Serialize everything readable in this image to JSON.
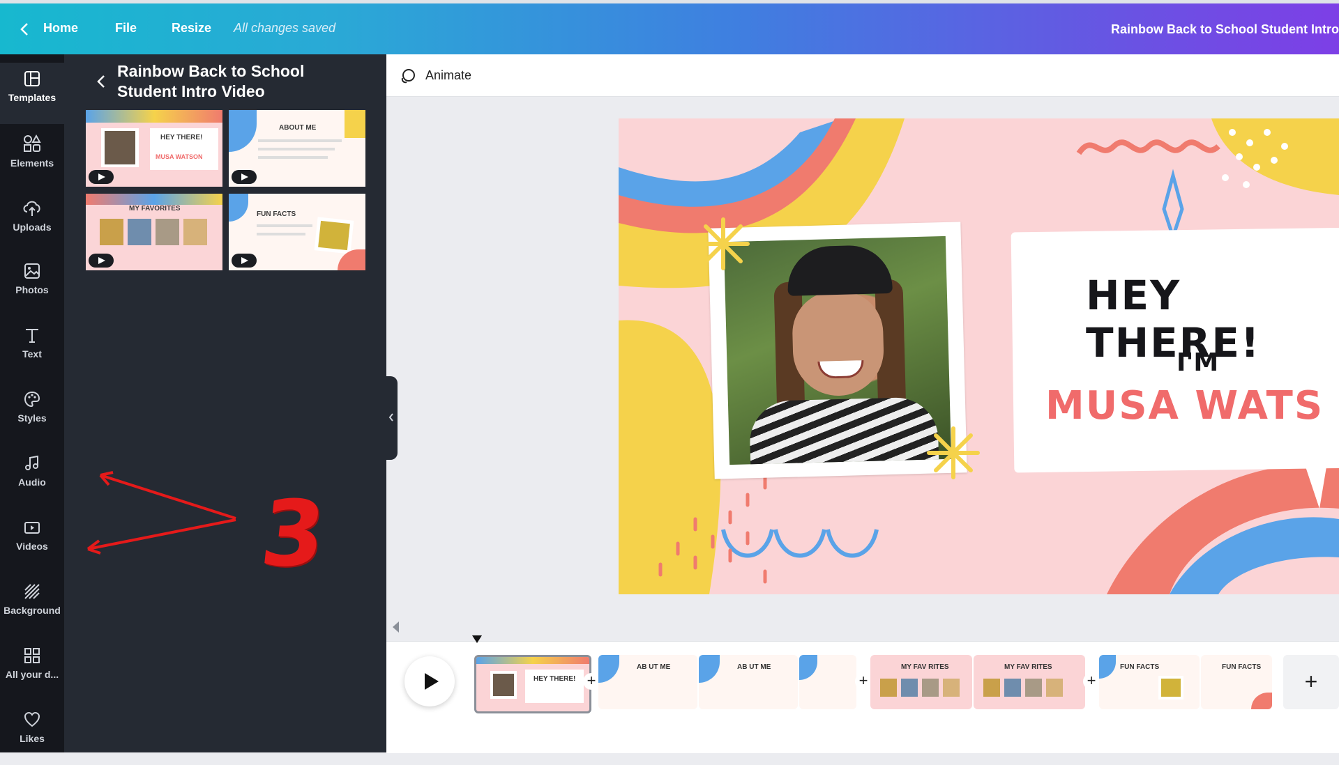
{
  "topbar": {
    "home_label": "Home",
    "file_label": "File",
    "resize_label": "Resize",
    "saved_status": "All changes saved",
    "document_title": "Rainbow Back to School Student Intro"
  },
  "rail": {
    "items": [
      {
        "label": "Templates",
        "icon": "templates-icon"
      },
      {
        "label": "Elements",
        "icon": "elements-icon"
      },
      {
        "label": "Uploads",
        "icon": "upload-cloud-icon"
      },
      {
        "label": "Photos",
        "icon": "photo-icon"
      },
      {
        "label": "Text",
        "icon": "text-icon"
      },
      {
        "label": "Styles",
        "icon": "palette-icon"
      },
      {
        "label": "Audio",
        "icon": "music-note-icon"
      },
      {
        "label": "Videos",
        "icon": "video-icon"
      },
      {
        "label": "Background",
        "icon": "background-hatch-icon"
      },
      {
        "label": "All your d...",
        "icon": "grid-icon"
      },
      {
        "label": "Likes",
        "icon": "heart-icon"
      }
    ]
  },
  "panel": {
    "title": "Rainbow Back to School Student Intro Video",
    "thumbnails": [
      {
        "caption": "HEY THERE!"
      },
      {
        "caption": "ABOUT ME"
      },
      {
        "caption": "MY FAVORITES"
      },
      {
        "caption": "FUN FACTS"
      }
    ]
  },
  "toolbar": {
    "animate_label": "Animate"
  },
  "slide": {
    "headline": "HEY THERE!",
    "intro": "I'M",
    "name": "MUSA WATS   N"
  },
  "timeline": {
    "clips": [
      {
        "caption": "HEY THERE!"
      },
      {
        "caption": "AB  UT ME"
      },
      {
        "caption": "AB  UT ME"
      },
      {
        "caption": "MY FAV  RITES"
      },
      {
        "caption": "MY FAV  RITES"
      },
      {
        "caption": "FUN FACTS"
      },
      {
        "caption": "FUN FACTS"
      }
    ],
    "add_page_label": "+"
  },
  "annotation": {
    "number": "3"
  },
  "colors": {
    "accent_pink": "#f06b6b",
    "panel_bg": "#252a33",
    "rail_bg": "#15171d",
    "annotation_red": "#e51a1a"
  }
}
